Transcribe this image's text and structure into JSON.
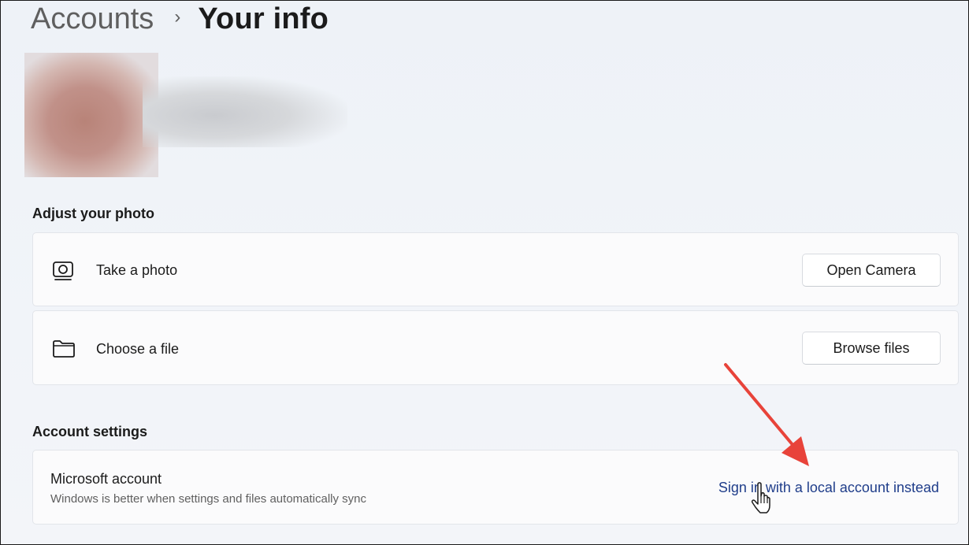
{
  "breadcrumb": {
    "parent": "Accounts",
    "separator": "›",
    "current": "Your info"
  },
  "avatar": {
    "icon": "user-avatar-blurred"
  },
  "adjust_photo": {
    "title": "Adjust your photo",
    "take_photo": {
      "icon": "camera-icon",
      "label": "Take a photo",
      "button": "Open Camera"
    },
    "choose_file": {
      "icon": "folder-icon",
      "label": "Choose a file",
      "button": "Browse files"
    }
  },
  "account_settings": {
    "title": "Account settings",
    "microsoft_account": {
      "title": "Microsoft account",
      "subtitle": "Windows is better when settings and files automatically sync",
      "link": "Sign in with a local account instead"
    }
  },
  "annotation": {
    "arrow_color": "#e8433a",
    "cursor_icon": "hand-pointer-icon"
  },
  "colors": {
    "background": "#eef2f7",
    "card": "#fbfbfc",
    "link": "#1f3d8a"
  }
}
